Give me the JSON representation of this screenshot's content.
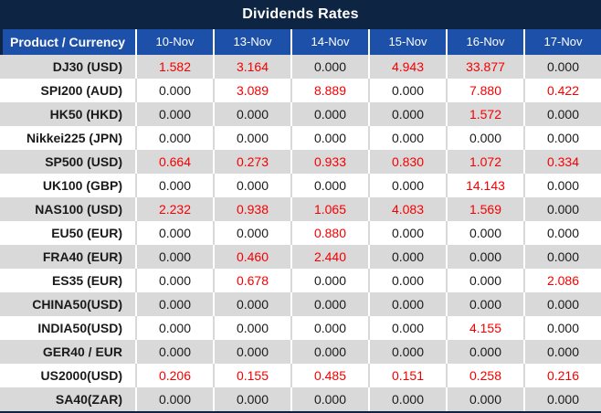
{
  "title": "Dividends Rates",
  "colors": {
    "title_bar_bg": "#0d2443",
    "title_text": "#ffffff",
    "header_bg": "#1d50a8",
    "header_text": "#ffffff",
    "row_gray_bg": "#d9d9d9",
    "row_white_bg": "#ffffff",
    "value_nonzero": "#f50000",
    "value_zero": "#1a1a1a"
  },
  "table": {
    "product_header": "Product / Currency",
    "date_headers": [
      "10-Nov",
      "13-Nov",
      "14-Nov",
      "15-Nov",
      "16-Nov",
      "17-Nov"
    ],
    "rows": [
      {
        "product": "DJ30 (USD)",
        "values": [
          "1.582",
          "3.164",
          "0.000",
          "4.943",
          "33.877",
          "0.000"
        ]
      },
      {
        "product": "SPI200 (AUD)",
        "values": [
          "0.000",
          "3.089",
          "8.889",
          "0.000",
          "7.880",
          "0.422"
        ]
      },
      {
        "product": "HK50 (HKD)",
        "values": [
          "0.000",
          "0.000",
          "0.000",
          "0.000",
          "1.572",
          "0.000"
        ]
      },
      {
        "product": "Nikkei225 (JPN)",
        "values": [
          "0.000",
          "0.000",
          "0.000",
          "0.000",
          "0.000",
          "0.000"
        ]
      },
      {
        "product": "SP500 (USD)",
        "values": [
          "0.664",
          "0.273",
          "0.933",
          "0.830",
          "1.072",
          "0.334"
        ]
      },
      {
        "product": "UK100 (GBP)",
        "values": [
          "0.000",
          "0.000",
          "0.000",
          "0.000",
          "14.143",
          "0.000"
        ]
      },
      {
        "product": "NAS100 (USD)",
        "values": [
          "2.232",
          "0.938",
          "1.065",
          "4.083",
          "1.569",
          "0.000"
        ]
      },
      {
        "product": "EU50 (EUR)",
        "values": [
          "0.000",
          "0.000",
          "0.880",
          "0.000",
          "0.000",
          "0.000"
        ]
      },
      {
        "product": "FRA40 (EUR)",
        "values": [
          "0.000",
          "0.460",
          "2.440",
          "0.000",
          "0.000",
          "0.000"
        ]
      },
      {
        "product": "ES35 (EUR)",
        "values": [
          "0.000",
          "0.678",
          "0.000",
          "0.000",
          "0.000",
          "2.086"
        ]
      },
      {
        "product": "CHINA50(USD)",
        "values": [
          "0.000",
          "0.000",
          "0.000",
          "0.000",
          "0.000",
          "0.000"
        ]
      },
      {
        "product": "INDIA50(USD)",
        "values": [
          "0.000",
          "0.000",
          "0.000",
          "0.000",
          "4.155",
          "0.000"
        ]
      },
      {
        "product": "GER40 / EUR",
        "values": [
          "0.000",
          "0.000",
          "0.000",
          "0.000",
          "0.000",
          "0.000"
        ]
      },
      {
        "product": "US2000(USD)",
        "values": [
          "0.206",
          "0.155",
          "0.485",
          "0.151",
          "0.258",
          "0.216"
        ]
      },
      {
        "product": "SA40(ZAR)",
        "values": [
          "0.000",
          "0.000",
          "0.000",
          "0.000",
          "0.000",
          "0.000"
        ]
      }
    ]
  }
}
